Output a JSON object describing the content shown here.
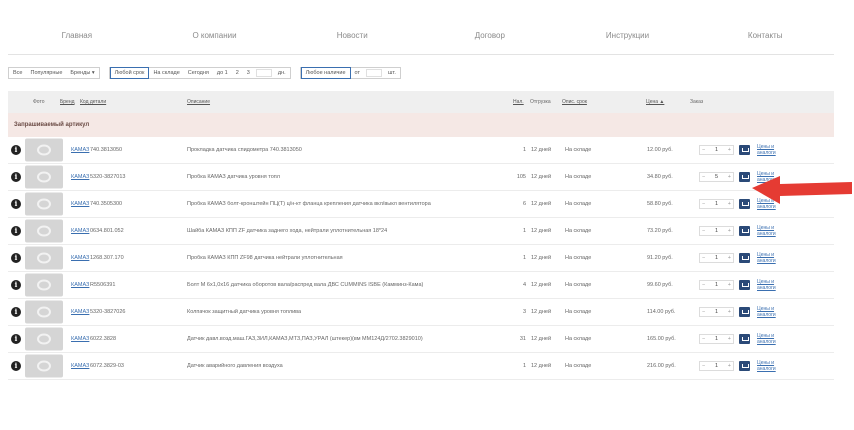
{
  "nav": [
    "Главная",
    "О компании",
    "Новости",
    "Договор",
    "Инструкции",
    "Контакты"
  ],
  "filters": {
    "group1": [
      "Все",
      "Популярные",
      "Бренды ▾"
    ],
    "group2": [
      "Любой срок",
      "На складе",
      "Сегодня",
      "до 1",
      "2",
      "3",
      "дн."
    ],
    "group3": [
      "Любое наличие",
      "от",
      "шт."
    ]
  },
  "header": {
    "photo": "Фото",
    "brand": "Бренд",
    "code": "Код детали",
    "desc": "Описание",
    "qty": "Нал.",
    "ship": "Отгрузка",
    "stock": "Опис. срок",
    "price": "Цена ▲",
    "order": "Заказ"
  },
  "group_title": "Запрашиваемый артикул",
  "rows": [
    {
      "brand": "КАМАЗ",
      "code": "740.3813050",
      "desc": "Прокладка датчика спидометра 740.3813050",
      "qty": "1",
      "ship": "12 дней",
      "stock": "На складе",
      "price": "12.00 руб.",
      "order_qty": "1",
      "links": [
        "Цены и",
        "аналоги"
      ]
    },
    {
      "brand": "КАМАЗ",
      "code": "5320-3827013",
      "desc": "Пробка КАМАЗ датчика уровня топл",
      "qty": "105",
      "ship": "12 дней",
      "stock": "На складе",
      "price": "34.80 руб.",
      "order_qty": "5",
      "links": [
        "Цены и",
        "аналоги"
      ]
    },
    {
      "brand": "КАМАЗ",
      "code": "740.3505300",
      "desc": "Пробка КАМАЗ болт-кронштейн ПЦ(Т) ц/н-кт фланца крепления датчика вкл/выкл вентилятора",
      "qty": "6",
      "ship": "12 дней",
      "stock": "На складе",
      "price": "58.80 руб.",
      "order_qty": "1",
      "links": [
        "Цены и",
        "аналоги"
      ]
    },
    {
      "brand": "КАМАЗ",
      "code": "0634.801.052",
      "desc": "Шайба КАМАЗ КПП ZF датчика заднего хода, нейтрали уплотнительная 18*24",
      "qty": "1",
      "ship": "12 дней",
      "stock": "На складе",
      "price": "73.20 руб.",
      "order_qty": "1",
      "links": [
        "Цены и",
        "аналоги"
      ]
    },
    {
      "brand": "КАМАЗ",
      "code": "1268.307.170",
      "desc": "Пробка КАМАЗ КПП ZF98 датчика нейтрали уплотнительная",
      "qty": "1",
      "ship": "12 дней",
      "stock": "На складе",
      "price": "91.20 руб.",
      "order_qty": "1",
      "links": [
        "Цены и",
        "аналоги"
      ]
    },
    {
      "brand": "КАМАЗ",
      "code": "R5506391",
      "desc": "Болт М 6х1,0х16 датчика оборотов вала/распред вала ДВС CUMMINS ISBE (Камминз-Кама)",
      "qty": "4",
      "ship": "12 дней",
      "stock": "На складе",
      "price": "99.60 руб.",
      "order_qty": "1",
      "links": [
        "Цены и",
        "аналоги"
      ]
    },
    {
      "brand": "КАМАЗ",
      "code": "5320-3827026",
      "desc": "Колпачок защитный датчика уровня топлива",
      "qty": "3",
      "ship": "12 дней",
      "stock": "На складе",
      "price": "114.00 руб.",
      "order_qty": "1",
      "links": [
        "Цены и",
        "аналоги"
      ]
    },
    {
      "brand": "КАМАЗ",
      "code": "6022.3828",
      "desc": "Датчик давл.возд.маш.ГАЗ,ЗИЛ,КАМАЗ,МТЗ,ПАЗ,УРАЛ (штекер)(вм ММ124Д/2702.3829010)",
      "qty": "31",
      "ship": "12 дней",
      "stock": "На складе",
      "price": "165.00 руб.",
      "order_qty": "1",
      "links": [
        "Цены и",
        "аналоги"
      ]
    },
    {
      "brand": "КАМАЗ",
      "code": "6072.3829-03",
      "desc": "Датчик аварийного давления воздуха",
      "qty": "1",
      "ship": "12 дней",
      "stock": "На складе",
      "price": "216.00 руб.",
      "order_qty": "1",
      "links": [
        "Цены и",
        "аналоги"
      ]
    }
  ],
  "colors": {
    "accent": "#2b4a78",
    "link": "#3a6fb0",
    "group_bg": "#f5e8e5",
    "arrow": "#e53b33"
  }
}
